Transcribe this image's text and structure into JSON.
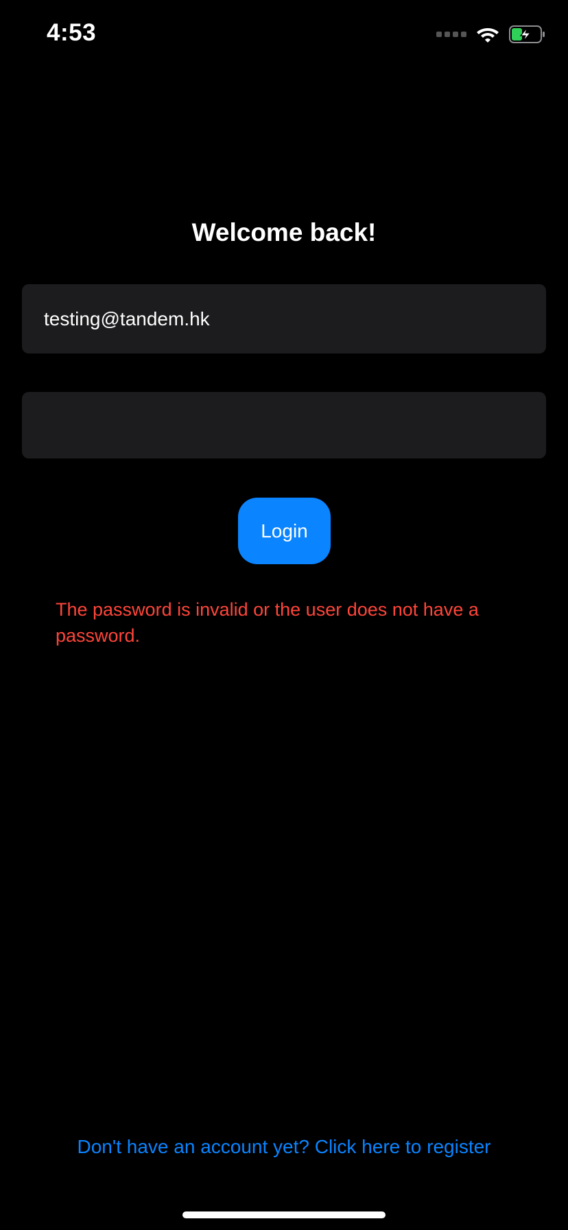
{
  "status_bar": {
    "time": "4:53",
    "icons": [
      "signal-icon",
      "wifi-icon",
      "battery-charging-icon"
    ],
    "battery_color": "#30d158"
  },
  "login": {
    "title": "Welcome back!",
    "email_value": "testing@tandem.hk",
    "password_value": "",
    "login_label": "Login",
    "error_message": "The password is invalid or the user does not have a password.",
    "register_link": "Don't have an account yet? Click here to register"
  },
  "colors": {
    "accent": "#0a84ff",
    "error": "#ff453a",
    "field_bg": "#1c1c1e",
    "background": "#000000"
  }
}
